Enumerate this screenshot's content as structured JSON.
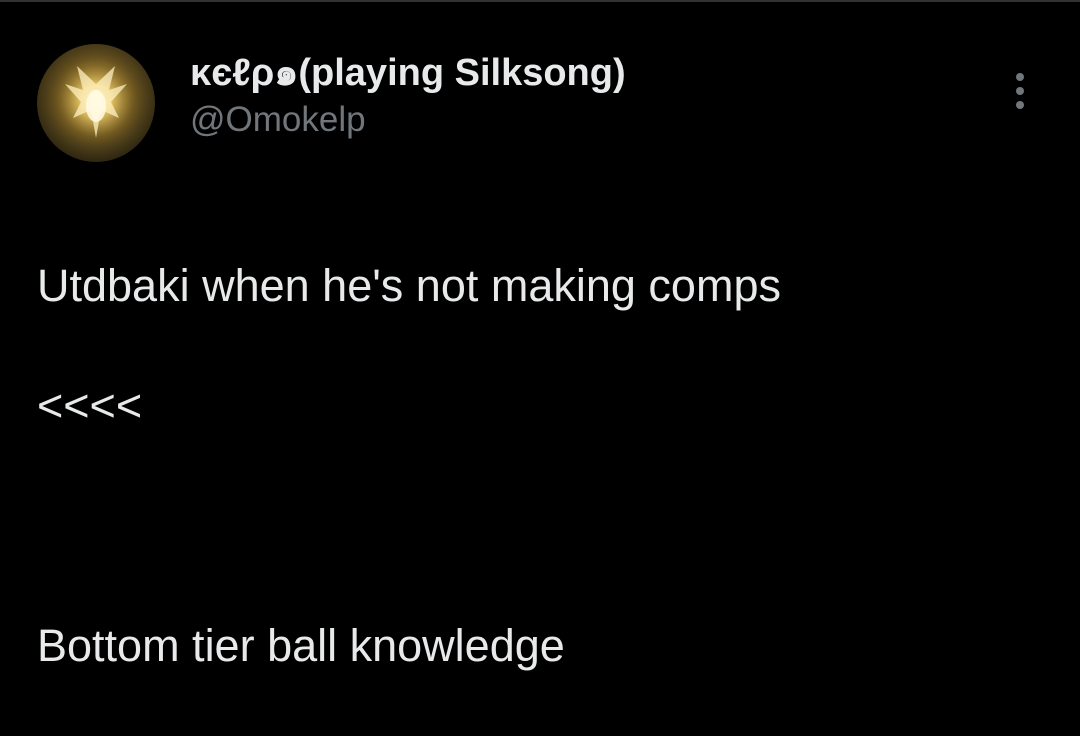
{
  "tweet": {
    "author": {
      "display_name": "κєℓρ๑(playing Silksong)",
      "handle": "@Omokelp",
      "avatar_icon": "glowing-winged-figure-avatar"
    },
    "menu_icon": "more-vertical-icon",
    "text_lines": [
      "Utdbaki when he's not making comps",
      "<<<<",
      "",
      "Bottom tier ball knowledge"
    ]
  },
  "colors": {
    "background": "#000000",
    "text_primary": "#e7e9ea",
    "text_secondary": "#71767b",
    "divider": "#2f3336"
  }
}
